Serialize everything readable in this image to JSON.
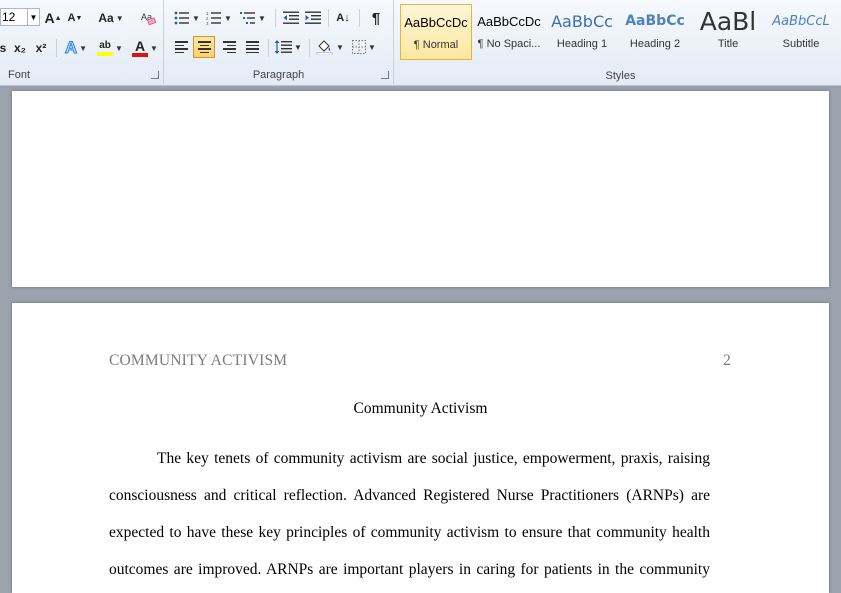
{
  "ribbon": {
    "font_group": {
      "label": "Font",
      "font_size": "12",
      "grow_label": "A",
      "shrink_label": "A",
      "change_case_label": "Aa",
      "subscript_label": "x₂",
      "superscript_label": "x²",
      "text_effects_label": "A",
      "font_color_label": "A",
      "highlight_label": "ab",
      "font_color": "#e01010",
      "highlight_color": "#ffff00"
    },
    "paragraph_group": {
      "label": "Paragraph",
      "sort_label": "A↓",
      "show_marks_label": "¶"
    },
    "styles_group": {
      "label": "Styles",
      "items": [
        {
          "preview": "AaBbCcDc",
          "name": "¶ Normal",
          "selected": true
        },
        {
          "preview": "AaBbCcDc",
          "name": "¶ No Spaci..."
        },
        {
          "preview": "AaBbCc",
          "name": "Heading 1"
        },
        {
          "preview": "AaBbCc",
          "name": "Heading 2"
        },
        {
          "preview": "AaBl",
          "name": "Title"
        },
        {
          "preview": "AaBbCcL",
          "name": "Subtitle"
        }
      ]
    }
  },
  "document": {
    "page2": {
      "running_head": "COMMUNITY ACTIVISM",
      "page_number": "2",
      "title": "Community Activism",
      "lines": [
        "The key tenets of community activism are social justice, empowerment, praxis, raising",
        "consciousness and critical reflection. Advanced Registered Nurse Practitioners (ARNPs) are",
        "expected to have these key principles of community activism to ensure that community health",
        "outcomes are improved. ARNPs are important players in caring for patients in the community"
      ]
    }
  }
}
